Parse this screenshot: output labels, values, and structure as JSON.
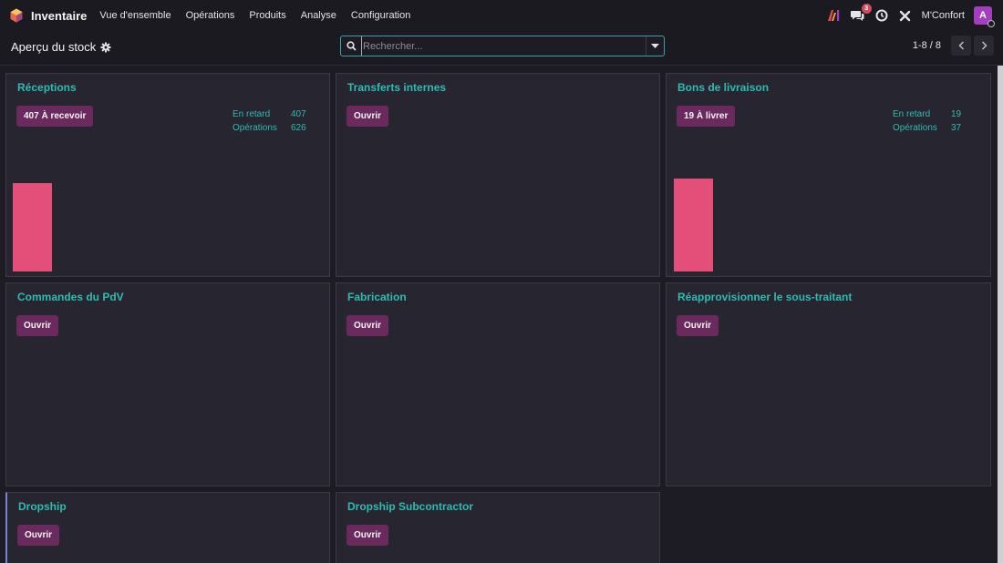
{
  "navbar": {
    "app_name": "Inventaire",
    "menu": [
      "Vue d'ensemble",
      "Opérations",
      "Produits",
      "Analyse",
      "Configuration"
    ],
    "messages_count": "3",
    "company": "M'Confort",
    "avatar_letter": "A"
  },
  "control": {
    "title": "Aperçu du stock",
    "search_placeholder": "Rechercher...",
    "pager": "1-8 / 8"
  },
  "colors": {
    "accent": "#2ebcb2",
    "button": "#6a2a5d",
    "bar": "#e44f7a"
  },
  "cards": [
    {
      "title": "Réceptions",
      "button": "407 À recevoir",
      "stats": [
        {
          "label": "En retard",
          "value": "407"
        },
        {
          "label": "Opérations",
          "value": "626"
        }
      ]
    },
    {
      "title": "Transferts internes",
      "button": "Ouvrir"
    },
    {
      "title": "Bons de livraison",
      "button": "19 À livrer",
      "stats": [
        {
          "label": "En retard",
          "value": "19"
        },
        {
          "label": "Opérations",
          "value": "37"
        }
      ]
    },
    {
      "title": "Commandes du PdV",
      "button": "Ouvrir"
    },
    {
      "title": "Fabrication",
      "button": "Ouvrir"
    },
    {
      "title": "Réapprovisionner le sous-traitant",
      "button": "Ouvrir"
    },
    {
      "title": "Dropship",
      "button": "Ouvrir"
    },
    {
      "title": "Dropship Subcontractor",
      "button": "Ouvrir"
    }
  ]
}
